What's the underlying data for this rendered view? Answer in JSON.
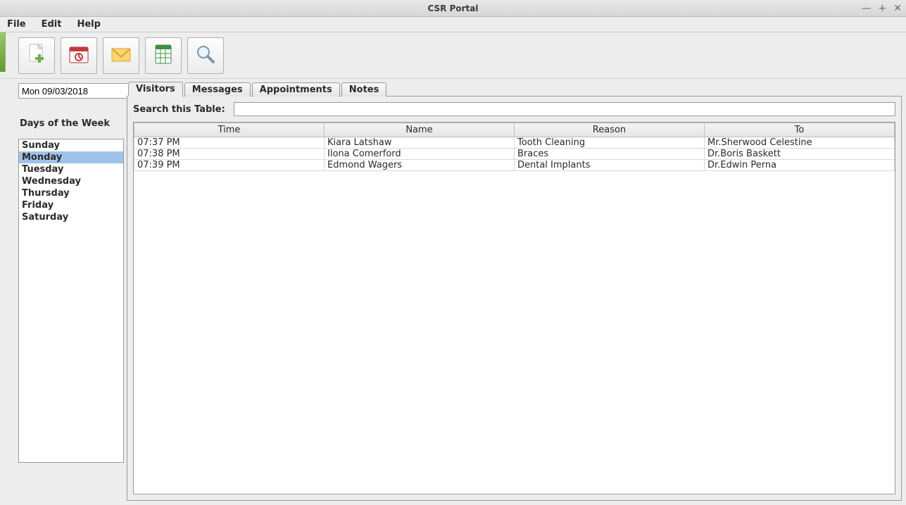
{
  "window": {
    "title": "CSR Portal"
  },
  "menubar": {
    "items": [
      "File",
      "Edit",
      "Help"
    ]
  },
  "toolbar": {
    "buttons": [
      {
        "name": "new-document",
        "icon": "new-document-icon"
      },
      {
        "name": "calendar",
        "icon": "calendar-icon"
      },
      {
        "name": "mail",
        "icon": "mail-icon"
      },
      {
        "name": "export-excel",
        "icon": "spreadsheet-icon"
      },
      {
        "name": "search",
        "icon": "search-icon"
      }
    ]
  },
  "sidebar": {
    "date_value": "Mon 09/03/2018",
    "days_title": "Days of the Week",
    "days": [
      "Sunday",
      "Monday",
      "Tuesday",
      "Wednesday",
      "Thursday",
      "Friday",
      "Saturday"
    ],
    "selected_day_index": 1
  },
  "tabs": {
    "items": [
      "Visitors",
      "Messages",
      "Appointments",
      "Notes"
    ],
    "active_index": 0
  },
  "search": {
    "label": "Search this Table:",
    "value": ""
  },
  "table": {
    "columns": [
      "Time",
      "Name",
      "Reason",
      "To"
    ],
    "rows": [
      {
        "time": "07:37 PM",
        "name": "Kiara Latshaw",
        "reason": "Tooth Cleaning",
        "to": "Mr.Sherwood Celestine"
      },
      {
        "time": "07:38 PM",
        "name": "Ilona Comerford",
        "reason": "Braces",
        "to": "Dr.Boris Baskett"
      },
      {
        "time": "07:39 PM",
        "name": "Edmond Wagers",
        "reason": "Dental Implants",
        "to": "Dr.Edwin Perna"
      }
    ]
  }
}
